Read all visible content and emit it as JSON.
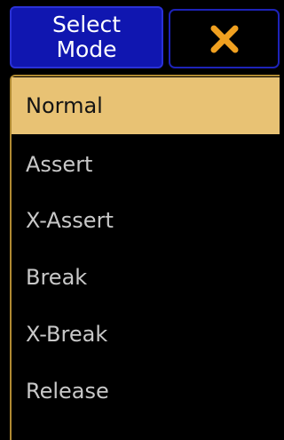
{
  "header": {
    "title_line1": "Select",
    "title_line2": "Mode",
    "close_color": "#f0a020"
  },
  "modes": {
    "selected_index": 0,
    "items": [
      {
        "label": "Normal"
      },
      {
        "label": "Assert"
      },
      {
        "label": "X-Assert"
      },
      {
        "label": "Break"
      },
      {
        "label": "X-Break"
      },
      {
        "label": "Release"
      }
    ]
  }
}
